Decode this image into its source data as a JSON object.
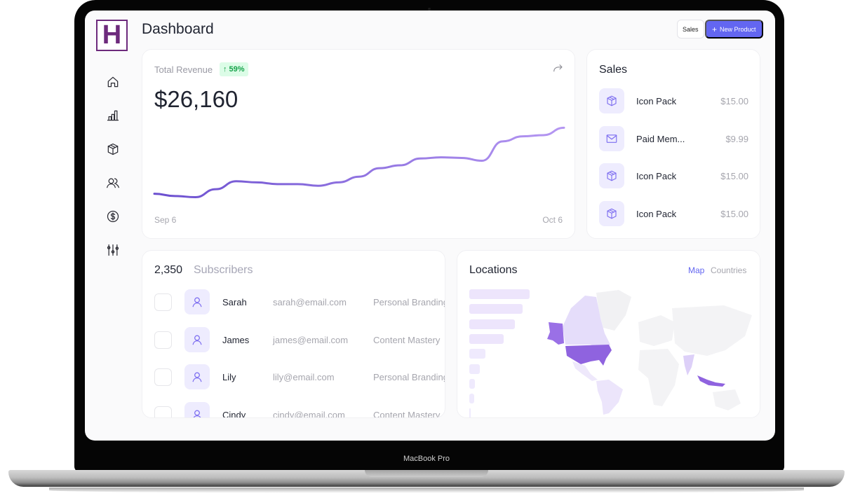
{
  "device": {
    "label": "MacBook Pro"
  },
  "app": {
    "logo_letter": "H",
    "page_title": "Dashboard",
    "colors": {
      "accent": "#6366f1",
      "logo": "#6d2a7c",
      "line_start": "#6b4fcf",
      "line_end": "#b597f2",
      "positive": "#16a34a"
    }
  },
  "sidebar": {
    "items": [
      {
        "icon": "home-icon",
        "label": "Home"
      },
      {
        "icon": "bar-chart-icon",
        "label": "Analytics"
      },
      {
        "icon": "box-icon",
        "label": "Products"
      },
      {
        "icon": "users-icon",
        "label": "Subscribers"
      },
      {
        "icon": "dollar-icon",
        "label": "Sales"
      },
      {
        "icon": "sliders-icon",
        "label": "Settings"
      }
    ]
  },
  "header": {
    "sales_button": "Sales",
    "new_product_button": "New Product",
    "new_product_icon": "+"
  },
  "revenue": {
    "label": "Total Revenue",
    "badge_arrow": "↑",
    "badge_value": "59%",
    "value": "$26,160",
    "x_start": "Sep 6",
    "x_end": "Oct 6"
  },
  "chart_data": {
    "type": "line",
    "title": "Total Revenue",
    "xlabel": "",
    "ylabel": "",
    "x_range_labels": [
      "Sep 6",
      "Oct 6"
    ],
    "x": [
      0,
      1,
      2,
      3,
      4,
      5,
      6,
      7,
      8,
      9,
      10,
      11,
      12,
      13,
      14,
      15,
      16,
      17,
      18,
      19,
      20
    ],
    "values": [
      30,
      26,
      24,
      38,
      52,
      50,
      47,
      47,
      44,
      50,
      60,
      75,
      80,
      92,
      94,
      93,
      88,
      122,
      131,
      133,
      146
    ],
    "ylim": [
      0,
      160
    ],
    "grid": false
  },
  "sales": {
    "title": "Sales",
    "items": [
      {
        "icon": "box-icon",
        "name": "Icon Pack",
        "price": "$15.00"
      },
      {
        "icon": "mail-icon",
        "name": "Paid Mem...",
        "price": "$9.99"
      },
      {
        "icon": "box-icon",
        "name": "Icon Pack",
        "price": "$15.00"
      },
      {
        "icon": "box-icon",
        "name": "Icon Pack",
        "price": "$15.00"
      }
    ]
  },
  "subscribers": {
    "count": "2,350",
    "label": "Subscribers",
    "rows": [
      {
        "name": "Sarah",
        "email": "sarah@email.com",
        "course": "Personal Branding"
      },
      {
        "name": "James",
        "email": "james@email.com",
        "course": "Content Mastery"
      },
      {
        "name": "Lily",
        "email": "lily@email.com",
        "course": "Personal Branding"
      },
      {
        "name": "Cindy",
        "email": "cindy@email.com",
        "course": "Content Mastery"
      }
    ]
  },
  "locations": {
    "title": "Locations",
    "tab_map": "Map",
    "tab_countries": "Countries",
    "active_tab": "Map",
    "bar_values": [
      100,
      88,
      76,
      57,
      27,
      18,
      9,
      8,
      1
    ],
    "highlighted_regions": [
      {
        "region": "United States",
        "level": "high"
      },
      {
        "region": "Alaska",
        "level": "high"
      },
      {
        "region": "Indonesia",
        "level": "high"
      },
      {
        "region": "India",
        "level": "medium"
      },
      {
        "region": "Canada",
        "level": "low"
      },
      {
        "region": "South America",
        "level": "low"
      },
      {
        "region": "Mexico",
        "level": "low"
      }
    ]
  }
}
